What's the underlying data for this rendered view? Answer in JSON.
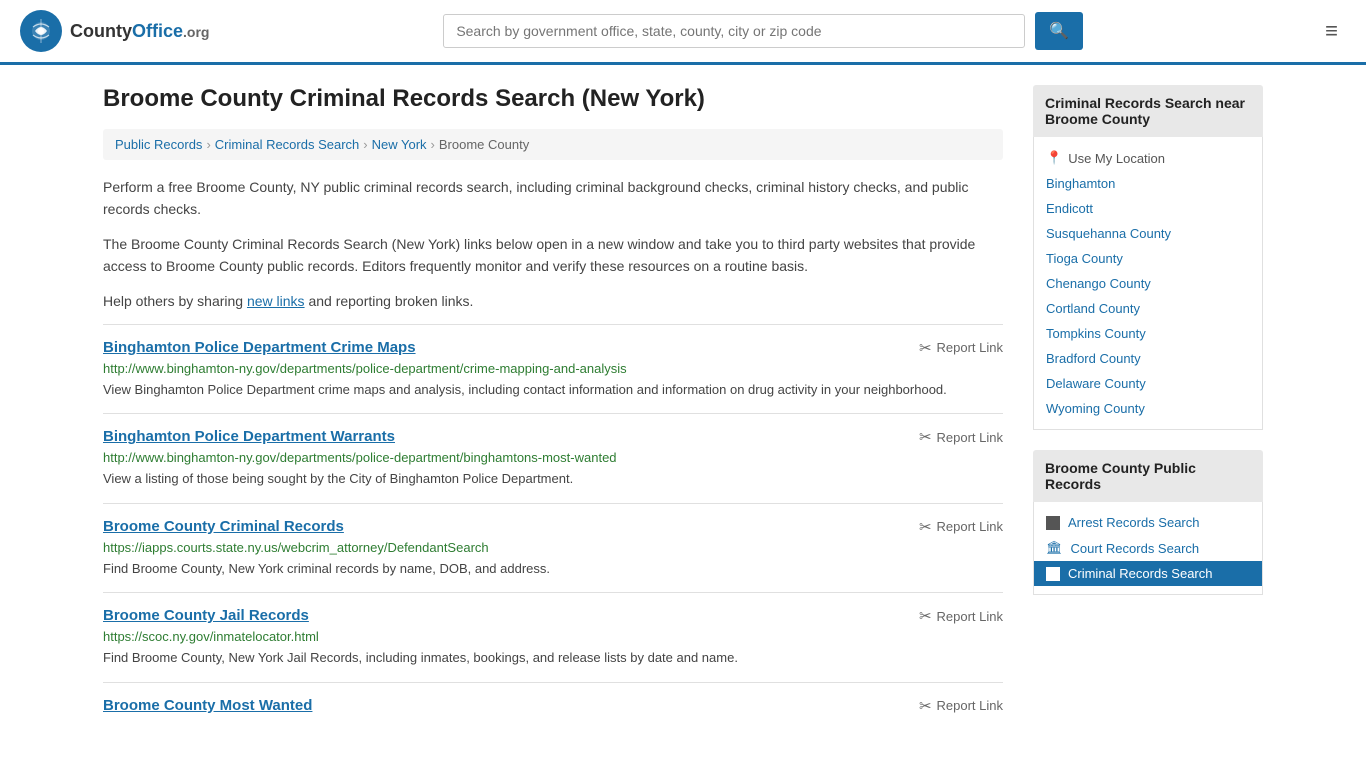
{
  "header": {
    "logo_text": "County",
    "logo_org": "Office",
    "logo_domain": ".org",
    "search_placeholder": "Search by government office, state, county, city or zip code",
    "search_btn_label": "🔍",
    "menu_btn_label": "≡"
  },
  "page": {
    "title": "Broome County Criminal Records Search (New York)",
    "breadcrumb": [
      "Public Records",
      "Criminal Records Search",
      "New York",
      "Broome County"
    ],
    "desc1": "Perform a free Broome County, NY public criminal records search, including criminal background checks, criminal history checks, and public records checks.",
    "desc2": "The Broome County Criminal Records Search (New York) links below open in a new window and take you to third party websites that provide access to Broome County public records. Editors frequently monitor and verify these resources on a routine basis.",
    "desc3_prefix": "Help others by sharing ",
    "desc3_link": "new links",
    "desc3_suffix": " and reporting broken links."
  },
  "results": [
    {
      "title": "Binghamton Police Department Crime Maps",
      "url": "http://www.binghamton-ny.gov/departments/police-department/crime-mapping-and-analysis",
      "desc": "View Binghamton Police Department crime maps and analysis, including contact information and information on drug activity in your neighborhood.",
      "report": "Report Link"
    },
    {
      "title": "Binghamton Police Department Warrants",
      "url": "http://www.binghamton-ny.gov/departments/police-department/binghamtons-most-wanted",
      "desc": "View a listing of those being sought by the City of Binghamton Police Department.",
      "report": "Report Link"
    },
    {
      "title": "Broome County Criminal Records",
      "url": "https://iapps.courts.state.ny.us/webcrim_attorney/DefendantSearch",
      "desc": "Find Broome County, New York criminal records by name, DOB, and address.",
      "report": "Report Link"
    },
    {
      "title": "Broome County Jail Records",
      "url": "https://scoc.ny.gov/inmatelocator.html",
      "desc": "Find Broome County, New York Jail Records, including inmates, bookings, and release lists by date and name.",
      "report": "Report Link"
    },
    {
      "title": "Broome County Most Wanted",
      "url": "",
      "desc": "",
      "report": "Report Link"
    }
  ],
  "sidebar": {
    "nearby_title": "Criminal Records Search near Broome County",
    "use_location": "Use My Location",
    "nearby_links": [
      "Binghamton",
      "Endicott",
      "Susquehanna County",
      "Tioga County",
      "Chenango County",
      "Cortland County",
      "Tompkins County",
      "Bradford County",
      "Delaware County",
      "Wyoming County"
    ],
    "public_records_title": "Broome County Public Records",
    "public_records_links": [
      {
        "label": "Arrest Records Search",
        "icon": "■",
        "active": false
      },
      {
        "label": "Court Records Search",
        "icon": "🏛",
        "active": false
      },
      {
        "label": "Criminal Records Search",
        "icon": "■",
        "active": true
      }
    ]
  }
}
